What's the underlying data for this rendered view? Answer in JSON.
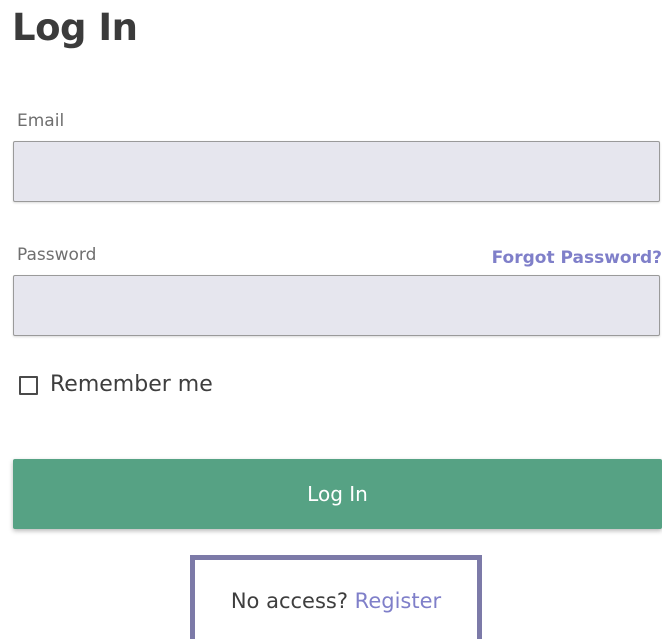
{
  "page": {
    "title": "Log In"
  },
  "form": {
    "email": {
      "label": "Email",
      "value": "",
      "placeholder": ""
    },
    "password": {
      "label": "Password",
      "value": "",
      "placeholder": "",
      "forgot_link": "Forgot Password?"
    },
    "remember": {
      "label": "Remember me",
      "checked": false
    },
    "submit_label": "Log In"
  },
  "footer": {
    "no_access_text": "No access? ",
    "register_link": "Register"
  },
  "colors": {
    "accent_button": "#56a284",
    "link": "#7f7fc9",
    "input_background": "#e6e6ee",
    "register_box_border": "#7c7aa8"
  }
}
